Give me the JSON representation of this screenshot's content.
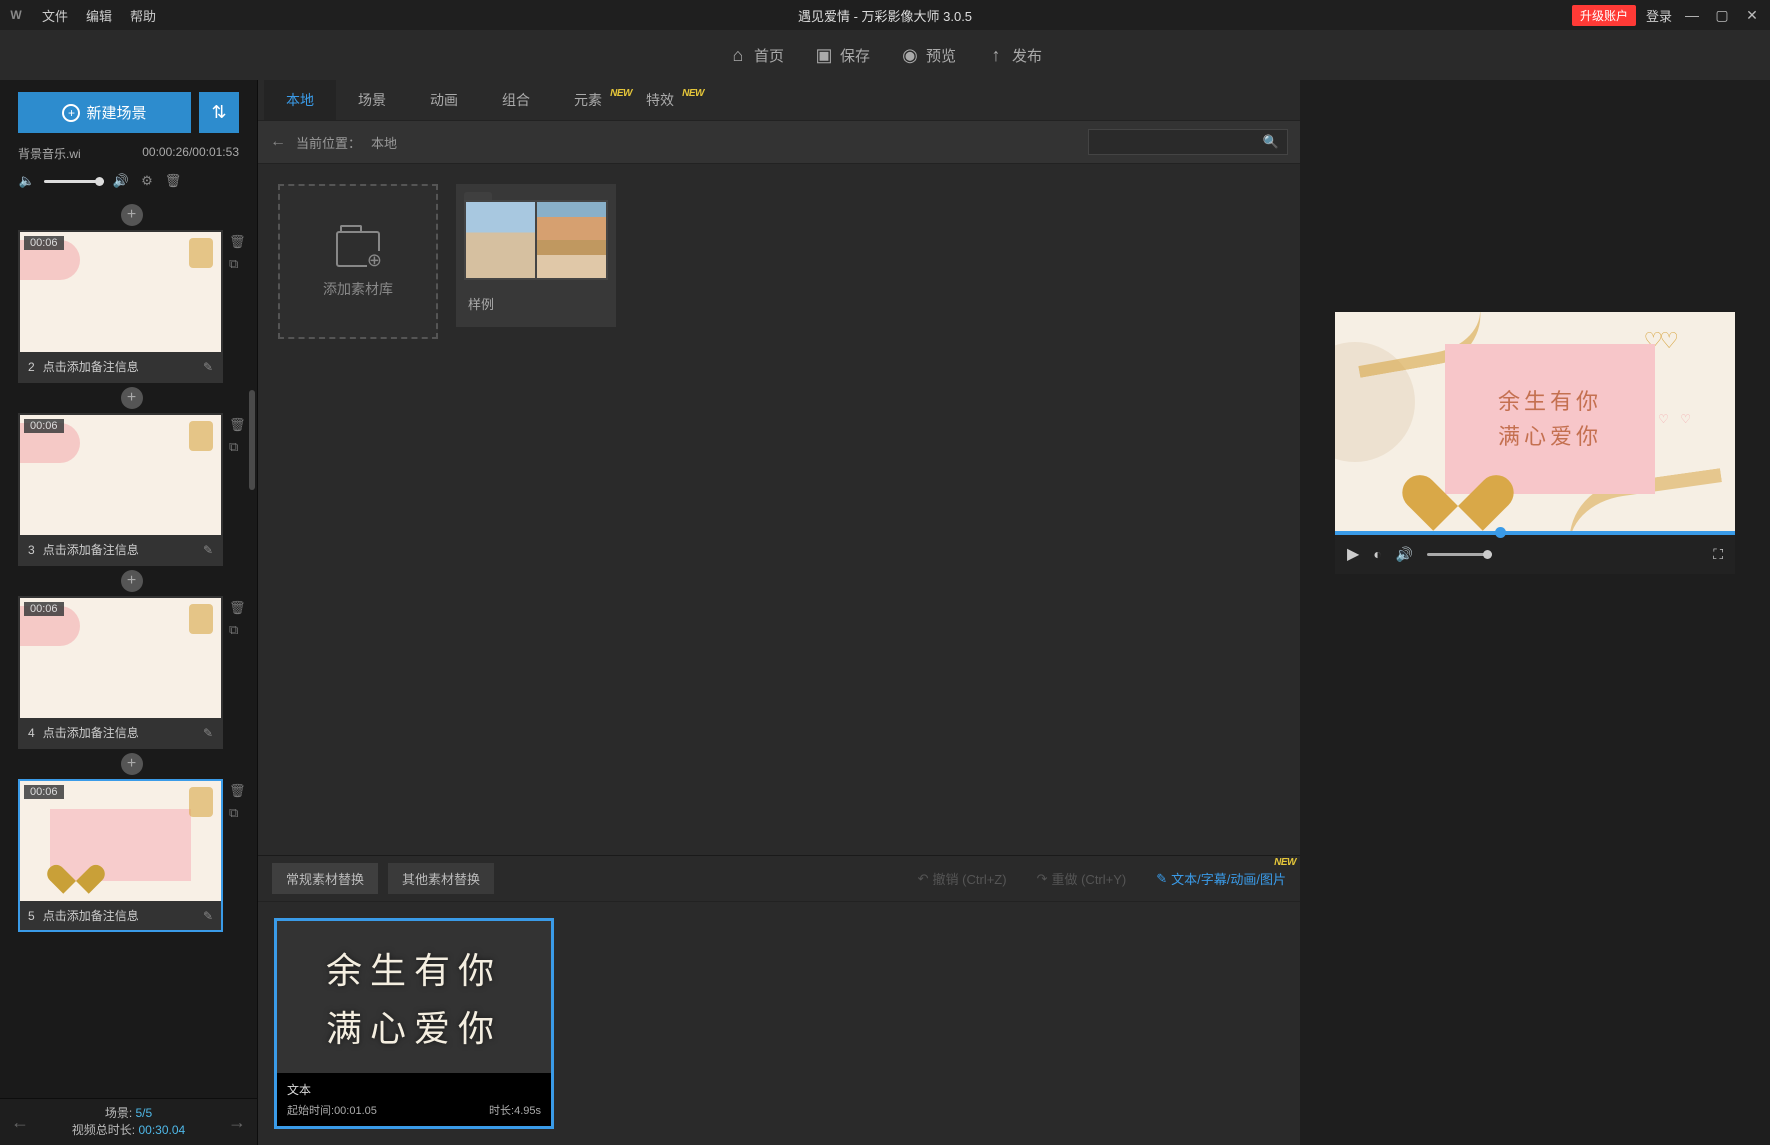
{
  "titlebar": {
    "menu": {
      "file": "文件",
      "edit": "编辑",
      "help": "帮助"
    },
    "title": "遇见爱情 - 万彩影像大师 3.0.5",
    "upgrade": "升级账户",
    "login": "登录"
  },
  "toolbar": {
    "home": "首页",
    "save": "保存",
    "preview": "预览",
    "publish": "发布"
  },
  "sidebar": {
    "new_scene": "新建场景",
    "audio_file": "背景音乐.wi",
    "audio_time": "00:00:26/00:01:53",
    "scenes": [
      {
        "index": "2",
        "duration": "00:06",
        "note": "点击添加备注信息",
        "heart": false
      },
      {
        "index": "3",
        "duration": "00:06",
        "note": "点击添加备注信息",
        "heart": false
      },
      {
        "index": "4",
        "duration": "00:06",
        "note": "点击添加备注信息",
        "heart": false
      },
      {
        "index": "5",
        "duration": "00:06",
        "note": "点击添加备注信息",
        "heart": true
      }
    ],
    "footer": {
      "scene_label": "场景:",
      "scene_val": "5/5",
      "total_label": "视频总时长:",
      "total_val": "00:30.04"
    }
  },
  "tabs": {
    "items": [
      {
        "label": "本地",
        "active": true,
        "badge": ""
      },
      {
        "label": "场景",
        "active": false,
        "badge": ""
      },
      {
        "label": "动画",
        "active": false,
        "badge": ""
      },
      {
        "label": "组合",
        "active": false,
        "badge": ""
      },
      {
        "label": "元素",
        "active": false,
        "badge": "NEW"
      },
      {
        "label": "特效",
        "active": false,
        "badge": "NEW"
      }
    ]
  },
  "breadcrumb": {
    "prefix": "当前位置：",
    "path": "本地",
    "search_placeholder": ""
  },
  "assets": {
    "add_library": "添加素材库",
    "sample": "样例"
  },
  "bottom": {
    "tab_normal": "常规素材替换",
    "tab_other": "其他素材替换",
    "undo": "撤销 (Ctrl+Z)",
    "redo": "重做 (Ctrl+Y)",
    "link": "文本/字幕/动画/图片",
    "link_badge": "NEW",
    "clip": {
      "line1": "余生有你",
      "line2": "满心爱你",
      "type": "文本",
      "start_label": "起始时间:",
      "start_val": "00:01.05",
      "dur_label": "时长:",
      "dur_val": "4.95s"
    }
  },
  "preview": {
    "line1": "余生有你",
    "line2": "满心爱你"
  }
}
